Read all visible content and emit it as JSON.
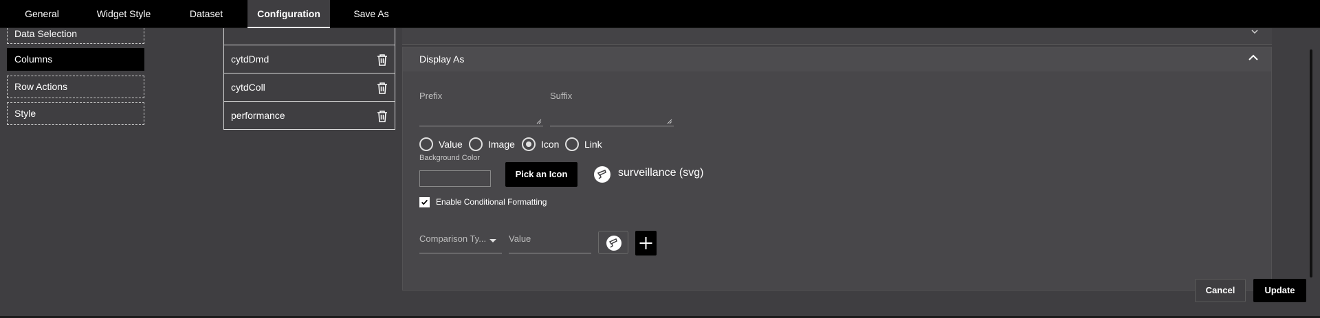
{
  "tabs": [
    {
      "label": "General",
      "active": false
    },
    {
      "label": "Widget Style",
      "active": false
    },
    {
      "label": "Dataset",
      "active": false
    },
    {
      "label": "Configuration",
      "active": true
    },
    {
      "label": "Save As",
      "active": false
    }
  ],
  "left_nav": [
    {
      "label": "Data Selection",
      "active": false
    },
    {
      "label": "Columns",
      "active": true
    },
    {
      "label": "Row Actions",
      "active": false
    },
    {
      "label": "Style",
      "active": false
    }
  ],
  "columns": [
    {
      "label": "cytdDmd"
    },
    {
      "label": "cytdColl"
    },
    {
      "label": "performance"
    }
  ],
  "display_as": {
    "title": "Display As",
    "prefix_label": "Prefix",
    "suffix_label": "Suffix",
    "prefix_value": "",
    "suffix_value": "",
    "radio_options": [
      {
        "label": "Value",
        "selected": false
      },
      {
        "label": "Image",
        "selected": false
      },
      {
        "label": "Icon",
        "selected": true
      },
      {
        "label": "Link",
        "selected": false
      }
    ],
    "background_color_label": "Background Color",
    "pick_icon_label": "Pick an Icon",
    "selected_icon": "surveillance (svg)",
    "conditional_formatting_label": "Enable Conditional Formatting",
    "conditional_formatting_enabled": true,
    "comparison_type_placeholder": "Comparison Ty...",
    "value_placeholder": "Value"
  },
  "actions": {
    "cancel": "Cancel",
    "update": "Update"
  },
  "colors": {
    "background": "#3f3e41",
    "tab_bar": "#000000",
    "panel": "#48474a",
    "primary_button": "#000000"
  }
}
